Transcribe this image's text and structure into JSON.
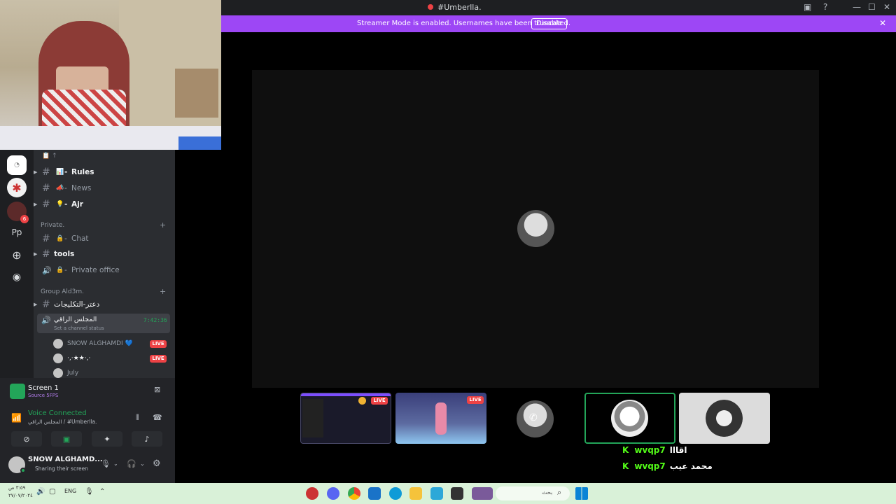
{
  "titlebar": {
    "title": "#Umberlla.",
    "minimize": "—",
    "maximize": "☐",
    "close": "✕"
  },
  "banner": {
    "message": "Streamer Mode is enabled. Usernames have been truncated.",
    "disable_label": "Disable"
  },
  "rail": {
    "dm_icon": "discord-home-icon",
    "pp_label": "Pp",
    "badge_count": "6"
  },
  "channels": {
    "top_icons": "📋 ↑",
    "items": [
      {
        "name": "Rules",
        "icon": "📊",
        "bold": true,
        "prefix": "- "
      },
      {
        "name": "News",
        "icon": "📣",
        "bold": false,
        "prefix": "- "
      },
      {
        "name": "Ajr",
        "icon": "💡",
        "bold": true,
        "prefix": "- "
      }
    ],
    "category_private": "Private.",
    "private_items": [
      {
        "name": "Chat",
        "prefix": "- "
      },
      {
        "name": "tools",
        "prefix": ""
      },
      {
        "name": "Private office",
        "prefix": "- "
      }
    ],
    "category_group": "Group Ald3m.",
    "group_text_channel": "دعتر-التكليجات",
    "voice_channel": {
      "name": "المجلس الراقي",
      "timer": "7:42:36",
      "status": "Set a channel status"
    },
    "voice_users": [
      {
        "name": "SNOW ALGHAMDI 💙",
        "live": "LIVE"
      },
      {
        "name": "·,·★★·,·",
        "live": "LIVE"
      },
      {
        "name": "July",
        "live": ""
      }
    ]
  },
  "panel": {
    "screen_title": "Screen 1",
    "screen_sub": "Source 5FPS",
    "voice_status": "Voice Connected",
    "voice_location": "المجلس الراقي / #Umberlla.",
    "username": "SNOW ALGHAMD...",
    "user_status": "Sharing their screen"
  },
  "tiles": [
    {
      "live": "LIVE"
    },
    {
      "live": "LIVE"
    }
  ],
  "chat": [
    {
      "user": "wvqp7",
      "message": "اقااا"
    },
    {
      "user": "wvqp7",
      "message": "محمد عيب"
    }
  ],
  "taskbar": {
    "clock_time": "٣:٥٩ ص",
    "clock_date": "٢٧/٠٧/٢٠٢٤",
    "lang": "ENG",
    "search_placeholder": "بحث"
  },
  "colors": {
    "banner": "#9d47f5",
    "live": "#ed4245",
    "voice_green": "#23a559",
    "kick_green": "#53fc18"
  }
}
